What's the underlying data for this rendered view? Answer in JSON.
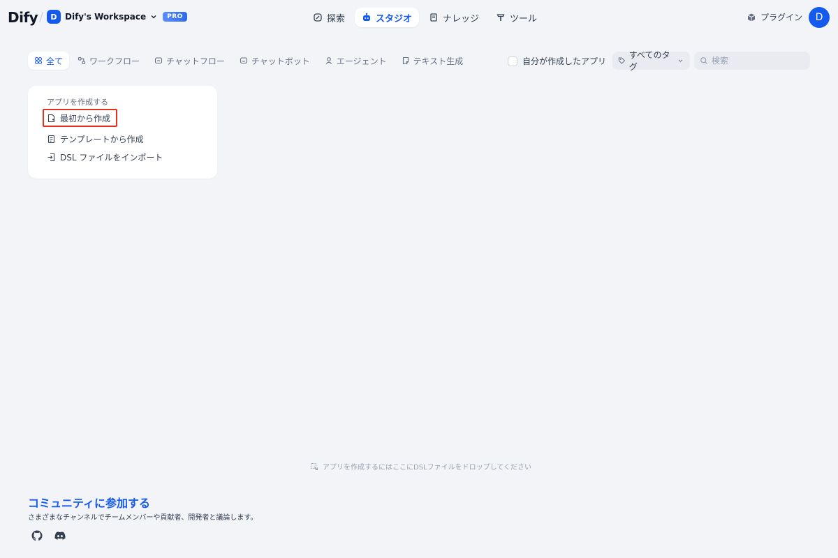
{
  "header": {
    "logo": "Dify",
    "workspace_initial": "D",
    "workspace_name": "Dify's Workspace",
    "plan_badge": "PRO",
    "nav": [
      {
        "label": "探索",
        "icon": "compass-icon"
      },
      {
        "label": "スタジオ",
        "icon": "robot-icon",
        "active": true
      },
      {
        "label": "ナレッジ",
        "icon": "book-icon"
      },
      {
        "label": "ツール",
        "icon": "hammer-icon"
      }
    ],
    "plugins_label": "プラグイン",
    "user_initial": "D"
  },
  "filters": {
    "tabs": [
      {
        "label": "全て",
        "icon": "grid-icon",
        "active": true
      },
      {
        "label": "ワークフロー",
        "icon": "workflow-icon"
      },
      {
        "label": "チャットフロー",
        "icon": "chatflow-icon"
      },
      {
        "label": "チャットボット",
        "icon": "chat-icon"
      },
      {
        "label": "エージェント",
        "icon": "agent-icon"
      },
      {
        "label": "テキスト生成",
        "icon": "file-text-icon"
      }
    ],
    "mine_label": "自分が作成したアプリ",
    "tag_select": "すべてのタグ",
    "search_placeholder": "検索"
  },
  "create_card": {
    "title": "アプリを作成する",
    "from_blank": "最初から作成",
    "from_template": "テンプレートから作成",
    "import_dsl": "DSL ファイルをインポート"
  },
  "drop_hint": "アプリを作成するにはここにDSLファイルをドロップしてください",
  "community": {
    "title": "コミュニティに参加する",
    "subtitle": "さまざまなチャンネルでチームメンバーや貢献者、開発者と議論します。"
  },
  "colors": {
    "accent": "#155aef",
    "background": "#f2f4f7",
    "highlight": "#e4301e"
  }
}
